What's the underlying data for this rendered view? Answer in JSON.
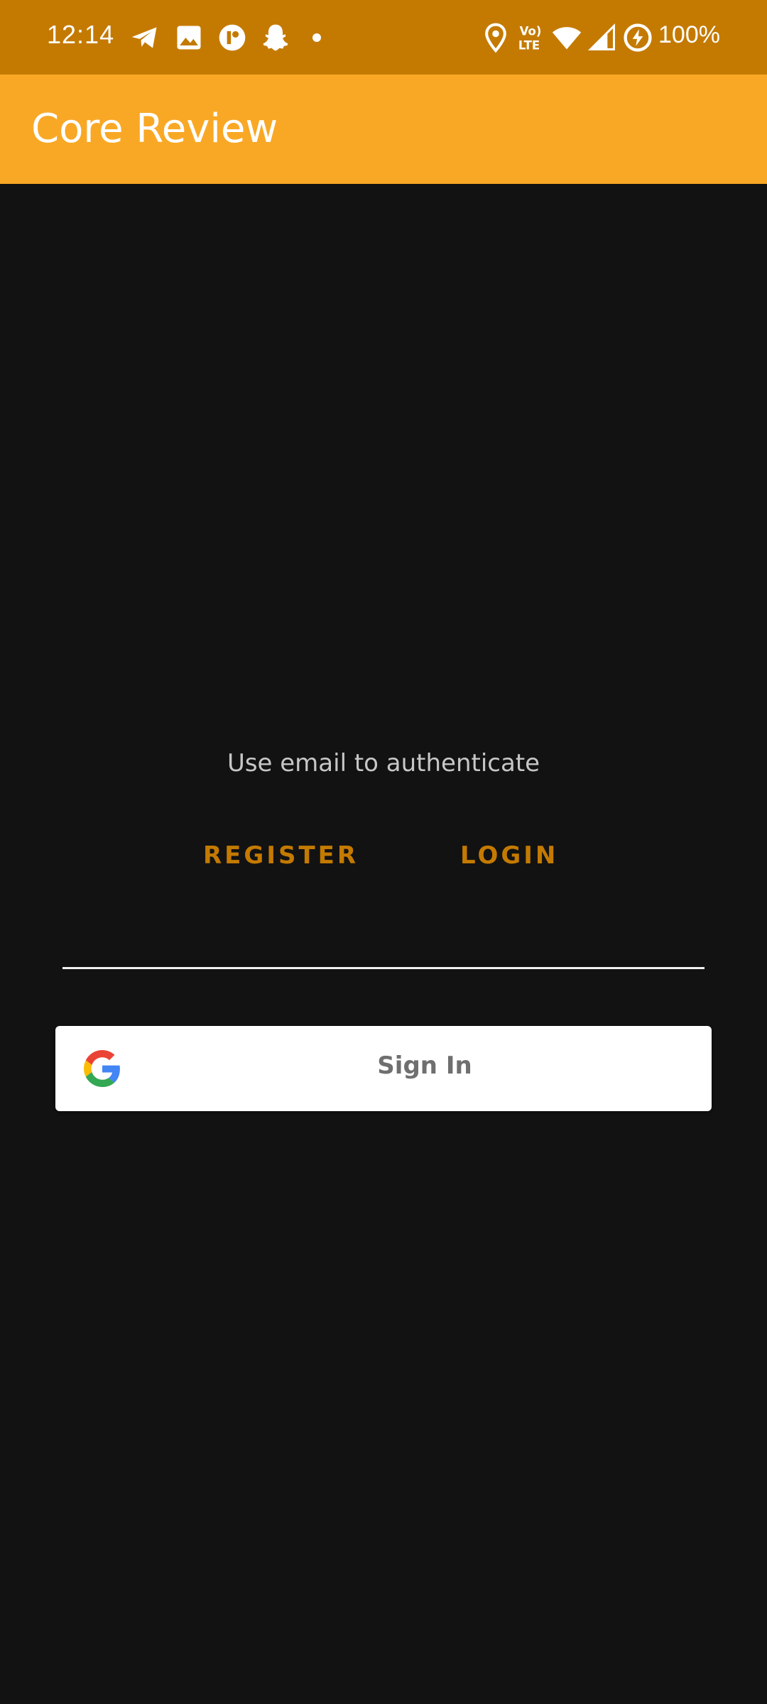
{
  "status_bar": {
    "time": "12:14",
    "battery": "100%",
    "icons": [
      "telegram-icon",
      "gallery-icon",
      "app-icon",
      "snapchat-icon",
      "notification-dot-icon",
      "location-icon",
      "volte-icon",
      "wifi-icon",
      "signal-icon",
      "battery-saver-icon"
    ],
    "volte_text": "Vo) LTE",
    "background": "#C47A00"
  },
  "app_bar": {
    "title": "Core Review",
    "background": "#F9A825"
  },
  "auth": {
    "prompt": "Use email to authenticate",
    "register_label": "REGISTER",
    "login_label": "LOGIN",
    "accent": "#C47A00"
  },
  "google_signin": {
    "label": "Sign In",
    "icon": "google-g-icon"
  }
}
